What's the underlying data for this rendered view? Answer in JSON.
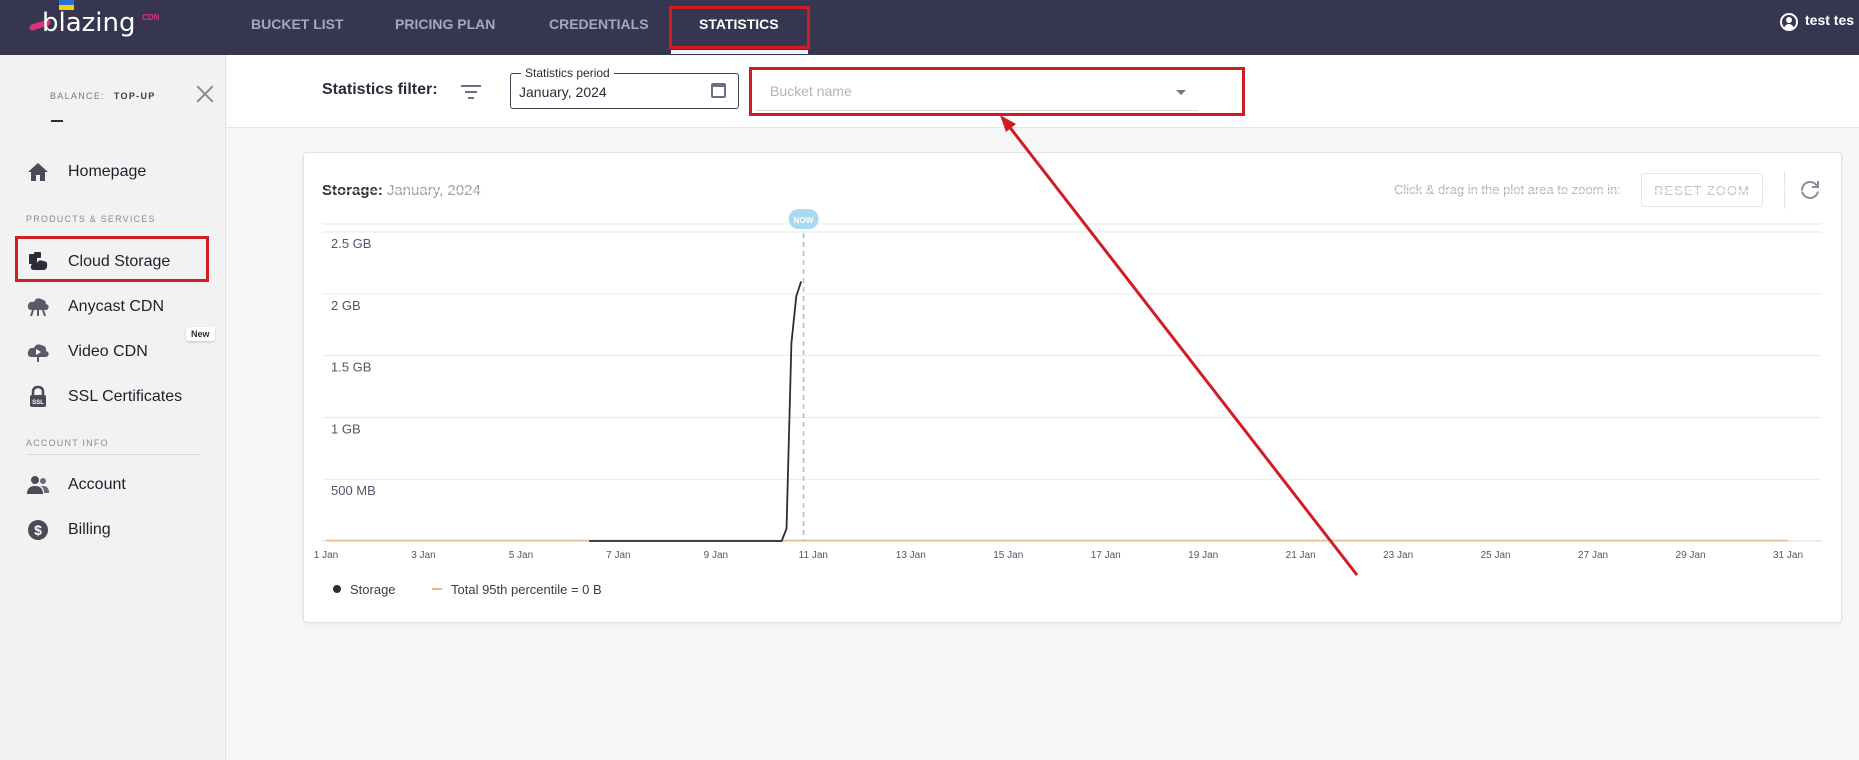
{
  "brand": {
    "logo_text": "blazing",
    "logo_suffix": "CDN",
    "accent": "#e0307a"
  },
  "topnav": {
    "items": [
      {
        "label": "BUCKET LIST",
        "active": false
      },
      {
        "label": "PRICING PLAN",
        "active": false
      },
      {
        "label": "CREDENTIALS",
        "active": false
      },
      {
        "label": "STATISTICS",
        "active": true
      }
    ],
    "user_name": "test tes",
    "user_icon": "user-circle-icon"
  },
  "sidebar": {
    "balance_label": "BALANCE:",
    "topup_label": "TOP-UP",
    "balance_value": "",
    "close_icon": "close-icon",
    "items": [
      {
        "label": "Homepage",
        "icon": "home-icon"
      },
      {
        "label": "Cloud Storage",
        "icon": "cloud-storage-icon"
      },
      {
        "label": "Anycast CDN",
        "icon": "cloud-network-icon"
      },
      {
        "label": "Video CDN",
        "icon": "video-cloud-icon",
        "badge": "New"
      },
      {
        "label": "SSL Certificates",
        "icon": "lock-ssl-icon"
      },
      {
        "label": "Account",
        "icon": "users-icon"
      },
      {
        "label": "Billing",
        "icon": "dollar-circle-icon"
      }
    ],
    "sections": {
      "products": "PRODUCTS & SERVICES",
      "account": "ACCOUNT INFO"
    }
  },
  "filter": {
    "label": "Statistics filter:",
    "period_legend": "Statistics period",
    "period_value": "January, 2024",
    "bucket_placeholder": "Bucket name"
  },
  "chart_header": {
    "title": "Storage:",
    "period": "January, 2024",
    "zoom_hint": "Click & drag in the plot area to zoom in:",
    "reset_zoom": "RESET ZOOM"
  },
  "highlight_color": "#d01d23",
  "chart_data": {
    "type": "line",
    "title": "Storage: January, 2024",
    "x_tick_labels": [
      "1 Jan",
      "3 Jan",
      "5 Jan",
      "7 Jan",
      "9 Jan",
      "11 Jan",
      "13 Jan",
      "15 Jan",
      "17 Jan",
      "19 Jan",
      "21 Jan",
      "23 Jan",
      "25 Jan",
      "27 Jan",
      "29 Jan",
      "31 Jan"
    ],
    "y_tick_labels": [
      "500 MB",
      "1 GB",
      "1.5 GB",
      "2 GB",
      "2.5 GB"
    ],
    "xlim": [
      1,
      31.3
    ],
    "ylim": [
      0,
      2.5
    ],
    "y_unit": "GB",
    "now_label": "NOW",
    "now_day": 10.8,
    "series": [
      {
        "name": "Storage",
        "color": "#2b2b3a",
        "points": [
          [
            6.4,
            0
          ],
          [
            10.35,
            0
          ],
          [
            10.45,
            0.1
          ],
          [
            10.55,
            1.6
          ],
          [
            10.65,
            1.98
          ],
          [
            10.75,
            2.1
          ]
        ]
      },
      {
        "name": "Total 95th percentile = 0 B",
        "color": "#e8b98e",
        "points": [
          [
            1,
            0
          ],
          [
            31,
            0
          ]
        ]
      }
    ],
    "legend": [
      "Storage",
      "Total 95th percentile = 0 B"
    ],
    "grid": true
  }
}
